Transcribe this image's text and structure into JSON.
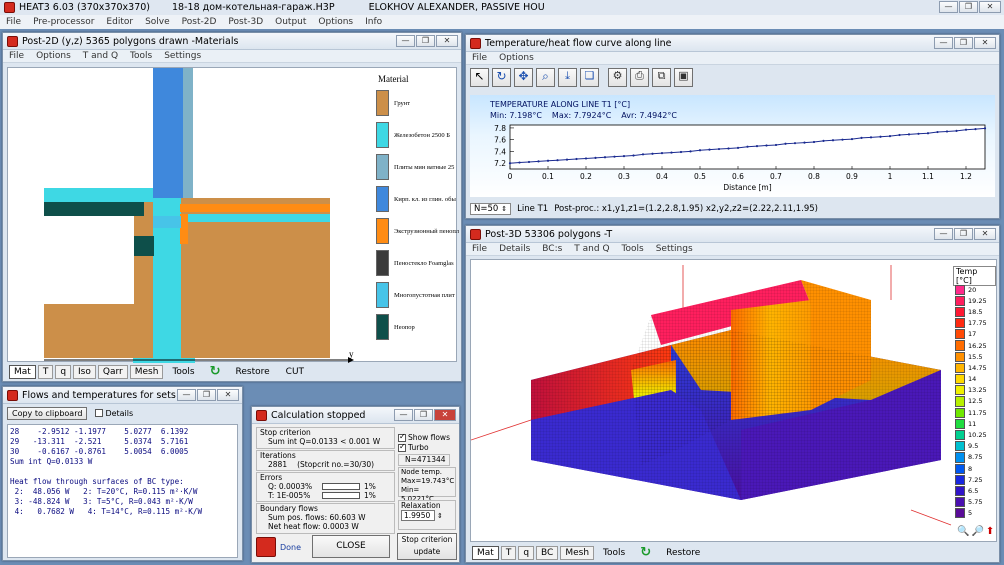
{
  "app": {
    "title": "HEAT3 6.03 (370x370x370)",
    "file": "18-18 дом-котельная-гараж.H3P",
    "user": "ELOKHOV ALEXANDER, PASSIVE HOU",
    "menu": [
      "File",
      "Pre-processor",
      "Editor",
      "Solve",
      "Post-2D",
      "Post-3D",
      "Output",
      "Options",
      "Info"
    ]
  },
  "win2d": {
    "title": "Post-2D (y,z) 5365 polygons drawn -Materials",
    "menu": [
      "File",
      "Options",
      "T and Q",
      "Tools",
      "Settings"
    ],
    "legend_title": "Material",
    "axis": "y",
    "legend": [
      {
        "label": "Грунт",
        "color": "#cc8f49"
      },
      {
        "label": "Железобетон 2500 Б",
        "color": "#3ed8e4"
      },
      {
        "label": "Плиты мин ватные 25",
        "color": "#7fb2c8"
      },
      {
        "label": "Кирп. кл. из глин. обы",
        "color": "#3f88dc"
      },
      {
        "label": "Экструзионный пенопл",
        "color": "#ff8c14"
      },
      {
        "label": "Пеностекло Foamglas",
        "color": "#3b3b3b"
      },
      {
        "label": "Многопустотная плит",
        "color": "#47c4e8"
      },
      {
        "label": "Неопор",
        "color": "#0e4f4a"
      }
    ],
    "tabs": [
      "Mat",
      "T",
      "q",
      "Iso",
      "Qarr",
      "Mesh"
    ],
    "tools": "Tools",
    "restore": "Restore",
    "cut": "CUT"
  },
  "wincurve": {
    "title": "Temperature/heat flow curve along line",
    "menu": [
      "File",
      "Options"
    ],
    "heading": "TEMPERATURE ALONG LINE T1 [°C]",
    "min": "Min: 7.198°C",
    "max": "Max: 7.7924°C",
    "avr": "Avr: 7.4942°C",
    "xlabel": "Distance [m]",
    "n": "N=50",
    "line": "Line T1",
    "postproc": "Post-proc.: x1,y1,z1=(1.2,2.8,1.95)  x2,y2,z2=(2.22,2.11,1.95)"
  },
  "chart_data": {
    "type": "line",
    "title": "TEMPERATURE ALONG LINE T1 [°C]",
    "xlabel": "Distance [m]",
    "ylabel": "",
    "xticks": [
      "0",
      "0.1",
      "0.2",
      "0.3",
      "0.4",
      "0.5",
      "0.6",
      "0.7",
      "0.8",
      "0.9",
      "1",
      "1.1",
      "1.2"
    ],
    "yticks": [
      "7.2",
      "7.4",
      "7.6",
      "7.8"
    ],
    "xlim": [
      0,
      1.25
    ],
    "ylim": [
      7.1,
      7.85
    ],
    "series": [
      {
        "x": [
          0,
          0.025,
          0.05,
          0.075,
          0.1,
          0.125,
          0.15,
          0.175,
          0.2,
          0.225,
          0.25,
          0.275,
          0.3,
          0.325,
          0.35,
          0.375,
          0.4,
          0.425,
          0.45,
          0.475,
          0.5,
          0.525,
          0.55,
          0.575,
          0.6,
          0.625,
          0.65,
          0.675,
          0.7,
          0.725,
          0.75,
          0.775,
          0.8,
          0.825,
          0.85,
          0.875,
          0.9,
          0.925,
          0.95,
          0.975,
          1.0,
          1.025,
          1.05,
          1.075,
          1.1,
          1.125,
          1.15,
          1.175,
          1.2,
          1.225,
          1.25
        ],
        "y": [
          7.198,
          7.21,
          7.22,
          7.23,
          7.24,
          7.25,
          7.26,
          7.27,
          7.28,
          7.29,
          7.3,
          7.31,
          7.32,
          7.33,
          7.35,
          7.36,
          7.37,
          7.38,
          7.39,
          7.4,
          7.42,
          7.43,
          7.44,
          7.45,
          7.46,
          7.48,
          7.49,
          7.5,
          7.51,
          7.53,
          7.54,
          7.55,
          7.56,
          7.58,
          7.59,
          7.6,
          7.61,
          7.63,
          7.64,
          7.65,
          7.66,
          7.68,
          7.69,
          7.7,
          7.71,
          7.73,
          7.74,
          7.75,
          7.77,
          7.78,
          7.7924
        ]
      }
    ]
  },
  "win3d": {
    "title": "Post-3D 53306 polygons -T",
    "menu": [
      "File",
      "Details",
      "BC:s",
      "T and Q",
      "Tools",
      "Settings"
    ],
    "legend_title": "Temp [°C]",
    "scale": [
      {
        "v": "20",
        "c": "#ff2b8a"
      },
      {
        "v": "19.25",
        "c": "#ff1f5e"
      },
      {
        "v": "18.5",
        "c": "#ff1a33"
      },
      {
        "v": "17.75",
        "c": "#ff2a10"
      },
      {
        "v": "17",
        "c": "#ff4a06"
      },
      {
        "v": "16.25",
        "c": "#ff6c00"
      },
      {
        "v": "15.5",
        "c": "#ff9000"
      },
      {
        "v": "14.75",
        "c": "#ffb400"
      },
      {
        "v": "14",
        "c": "#ffd800"
      },
      {
        "v": "13.25",
        "c": "#f0f000"
      },
      {
        "v": "12.5",
        "c": "#b8f000"
      },
      {
        "v": "11.75",
        "c": "#70e800"
      },
      {
        "v": "11",
        "c": "#20dc40"
      },
      {
        "v": "10.25",
        "c": "#00d090"
      },
      {
        "v": "9.5",
        "c": "#00c0d0"
      },
      {
        "v": "8.75",
        "c": "#0090f0"
      },
      {
        "v": "8",
        "c": "#0058f0"
      },
      {
        "v": "7.25",
        "c": "#1828e0"
      },
      {
        "v": "6.5",
        "c": "#3014c8"
      },
      {
        "v": "5.75",
        "c": "#4a10b0"
      },
      {
        "v": "5",
        "c": "#5a0c98"
      }
    ],
    "tabs": [
      "Mat",
      "T",
      "q",
      "BC",
      "Mesh"
    ],
    "tools": "Tools",
    "restore": "Restore"
  },
  "winflows": {
    "title": "Flows and temperatures for sets (F1...",
    "copy": "Copy to clipboard",
    "details": "Details",
    "lines": [
      "28    -2.9512 -1.1977    5.0277  6.1392",
      "29   -13.311  -2.521     5.0374  5.7161",
      "30    -0.6167 -0.8761    5.0054  6.0005",
      "Sum int Q=0.0133 W",
      "",
      "Heat flow through surfaces of BC type:",
      " 2:  48.056 W   2: T=20°C, R=0.115 m²·K/W",
      " 3: -48.824 W   3: T=5°C, R=0.043 m²·K/W",
      " 4:   0.7682 W   4: T=14°C, R=0.115 m²·K/W"
    ]
  },
  "wincalc": {
    "title": "Calculation stopped",
    "stop_label": "Stop criterion",
    "stop_value": "Sum int Q=0.0133 < 0.001 W",
    "iter_label": "Iterations",
    "iter_value": "2881",
    "iter_stop": "(Stopcrit no.=30/30)",
    "err_label": "Errors",
    "err_q": "Q: 0.0003%",
    "err_t": "T: 1E-005%",
    "pct1": "1%",
    "pct2": "1%",
    "bf_label": "Boundary flows",
    "bf_pos": "Sum pos. flows: 60.603 W",
    "bf_net": "Net heat flow:  0.0003 W",
    "show_flows": "Show flows",
    "turbo": "Turbo",
    "n": "N=471344",
    "nt_label": "Node temp.",
    "nt_max": "Max=19.743°C",
    "nt_min": "Min= 5.0221°C",
    "relax_label": "Relaxation",
    "relax_value": "1.9950",
    "done": "Done",
    "close": "CLOSE",
    "stopcrit": "Stop criterion",
    "update": "update"
  }
}
